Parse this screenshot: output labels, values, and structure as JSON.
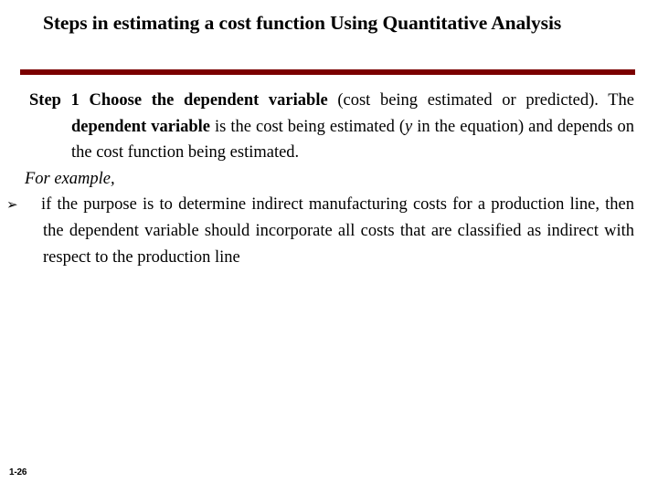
{
  "slide": {
    "title": "Steps in estimating a cost function Using Quantitative Analysis",
    "divider_color": "#7B0000",
    "background_color": "#FFFFFF",
    "text_color": "#000000"
  },
  "body": {
    "step": {
      "label": "Step 1",
      "text_1": "Choose the dependent variable",
      "text_2": " (cost being estimated or predicted). The ",
      "text_3": "dependent variable",
      "text_4": " is the cost being estimated (",
      "variable": "y",
      "text_5": " in the equation) and depends on the cost function being estimated."
    },
    "for_example": "For example,",
    "bullet": {
      "marker": "arrowhead-bullet-glyph",
      "marker_char": "➢",
      "text": "if the purpose is to determine indirect manufacturing costs for a production line, then the dependent variable should incorporate all costs that are classified as indirect with respect to the production line"
    }
  },
  "footer": {
    "page_number": "1-26"
  }
}
